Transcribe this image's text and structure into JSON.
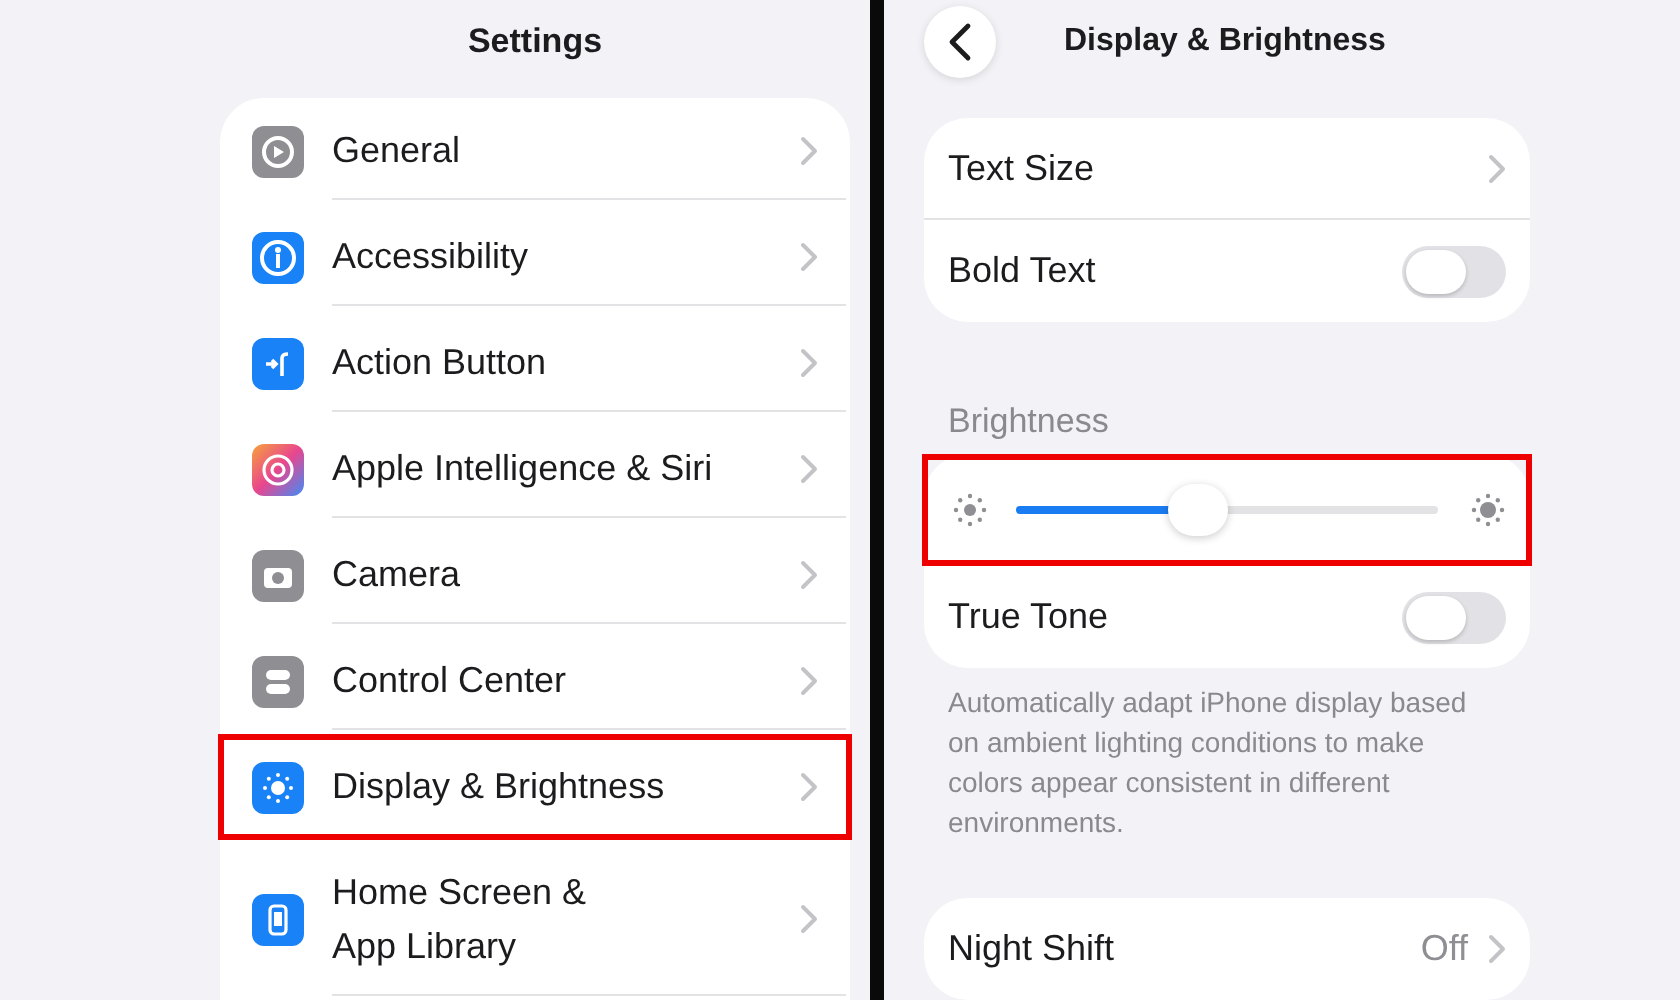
{
  "left": {
    "title": "Settings",
    "items": [
      {
        "label": "General",
        "highlighted": false
      },
      {
        "label": "Accessibility",
        "highlighted": false
      },
      {
        "label": "Action Button",
        "highlighted": false
      },
      {
        "label": "Apple Intelligence & Siri",
        "highlighted": false
      },
      {
        "label": "Camera",
        "highlighted": false
      },
      {
        "label": "Control Center",
        "highlighted": false
      },
      {
        "label": "Display & Brightness",
        "highlighted": true
      },
      {
        "label": "Home Screen &\nApp Library",
        "highlighted": false
      }
    ]
  },
  "right": {
    "title": "Display & Brightness",
    "groups": [
      {
        "rows": [
          {
            "kind": "link",
            "label": "Text Size"
          },
          {
            "kind": "toggle",
            "label": "Bold Text",
            "on": false
          }
        ]
      },
      {
        "header": "Brightness",
        "rows": [
          {
            "kind": "slider",
            "level": 0.43,
            "highlighted": true
          },
          {
            "kind": "toggle",
            "label": "True Tone",
            "on": false
          }
        ],
        "footer": "Automatically adapt iPhone display based on ambient lighting conditions to make colors appear consistent in different environments."
      },
      {
        "rows": [
          {
            "kind": "link",
            "label": "Night Shift",
            "value": "Off"
          }
        ]
      }
    ]
  }
}
